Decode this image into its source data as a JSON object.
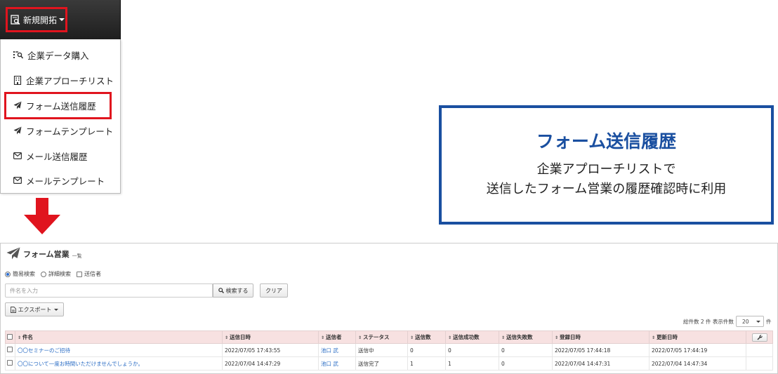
{
  "nav": {
    "label": "新規開拓"
  },
  "dropdown": {
    "items": [
      {
        "label": "企業データ購入",
        "icon": "list-search-icon"
      },
      {
        "label": "企業アプローチリスト",
        "icon": "building-icon"
      },
      {
        "label": "フォーム送信履歴",
        "icon": "paper-plane-icon"
      },
      {
        "label": "フォームテンプレート",
        "icon": "paper-plane-icon"
      },
      {
        "label": "メール送信履歴",
        "icon": "envelope-icon"
      },
      {
        "label": "メールテンプレート",
        "icon": "envelope-icon"
      }
    ]
  },
  "info": {
    "title": "フォーム送信履歴",
    "line1": "企業アプローチリストで",
    "line2": "送信したフォーム営業の履歴確認時に利用"
  },
  "panel": {
    "title": "フォーム営業",
    "subtitle": "一覧",
    "search_modes": [
      "簡易検索",
      "詳細検索"
    ],
    "sender_checkbox": "送信者",
    "search_placeholder": "件名を入力",
    "search_button": "検索する",
    "clear_button": "クリア",
    "export_button": "エクスポート",
    "total_label": "総件数 2 件 表示件数",
    "page_size": "20",
    "page_size_unit": "件"
  },
  "table": {
    "headers": [
      "件名",
      "送信日時",
      "送信者",
      "ステータス",
      "送信数",
      "送信成功数",
      "送信失敗数",
      "登録日時",
      "更新日時"
    ],
    "rows": [
      [
        "〇〇セミナーのご招待",
        "2022/07/05 17:43:55",
        "池口 武",
        "送信中",
        "0",
        "0",
        "0",
        "2022/07/05 17:44:18",
        "2022/07/05 17:44:19"
      ],
      [
        "〇〇について一度お時間いただけませんでしょうか。",
        "2022/07/04 14:47:29",
        "池口 武",
        "送信完了",
        "1",
        "1",
        "0",
        "2022/07/04 14:47:31",
        "2022/07/04 14:47:34"
      ]
    ]
  },
  "colors": {
    "highlight_red": "#e0141e",
    "info_blue": "#1a4fa0",
    "link_blue": "#2a6cc4",
    "header_pink": "#f7e1e1"
  }
}
